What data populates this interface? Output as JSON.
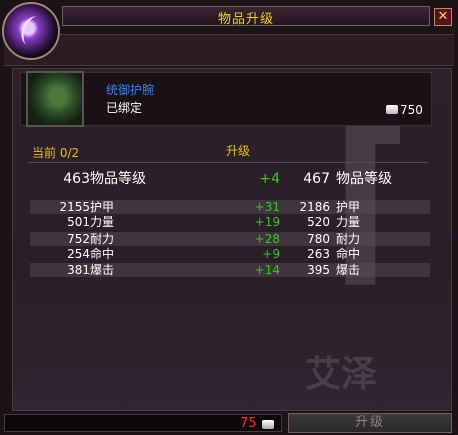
{
  "window": {
    "title": "物品升级",
    "close_label": "✕"
  },
  "item": {
    "name": "统御护腕",
    "binding": "已绑定",
    "value": "750"
  },
  "labels": {
    "current": "当前 0/2",
    "upgrade": "升级"
  },
  "item_level": {
    "current": "463",
    "name": "物品等级",
    "delta": "+4",
    "new": "467"
  },
  "stats": [
    {
      "current": "2155",
      "name": "护甲",
      "delta": "+31",
      "new": "2186"
    },
    {
      "current": "501",
      "name": "力量",
      "delta": "+19",
      "new": "520"
    },
    {
      "current": "752",
      "name": "耐力",
      "delta": "+28",
      "new": "780"
    },
    {
      "current": "254",
      "name": "命中",
      "delta": "+9",
      "new": "263"
    },
    {
      "current": "381",
      "name": "爆击",
      "delta": "+14",
      "new": "395"
    }
  ],
  "footer": {
    "cost": "75",
    "upgrade_button": "升级"
  },
  "watermark": "艾泽",
  "colors": {
    "title": "#f5d200",
    "item_name": "#3c7ef0",
    "delta": "#2ecc1a",
    "cost": "#ff2a2a"
  }
}
